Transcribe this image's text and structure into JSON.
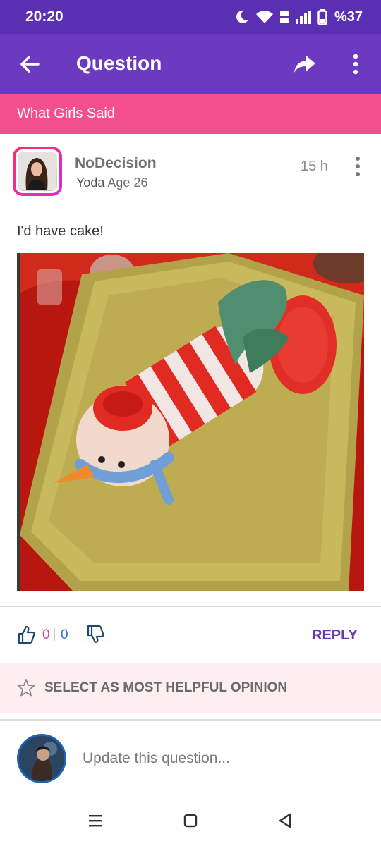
{
  "status_bar": {
    "time": "20:20",
    "battery_text": "%37"
  },
  "app_bar": {
    "title": "Question"
  },
  "section": {
    "title": "What Girls Said"
  },
  "post": {
    "author": "NoDecision",
    "level": "Yoda",
    "age": "Age 26",
    "time": "15 h",
    "text": "I'd have cake!",
    "likes": "0",
    "dislikes": "0",
    "reply_label": "REPLY",
    "helpful_label": "SELECT AS MOST HELPFUL OPINION"
  },
  "composer": {
    "placeholder": "Update this question..."
  },
  "colors": {
    "status_bar": "#5b2fb2",
    "app_bar": "#6b3ac0",
    "banner": "#f5508e",
    "accent": "#6a36b4",
    "like": "#e0408a",
    "dislike": "#2f6fd6"
  },
  "icons": [
    "moon-icon",
    "wifi-icon",
    "volte-icon",
    "signal-icon",
    "battery-icon",
    "back-arrow-icon",
    "share-icon",
    "more-vert-icon",
    "thumbs-up-icon",
    "thumbs-down-icon",
    "star-icon",
    "recents-icon",
    "home-icon",
    "nav-back-icon"
  ]
}
